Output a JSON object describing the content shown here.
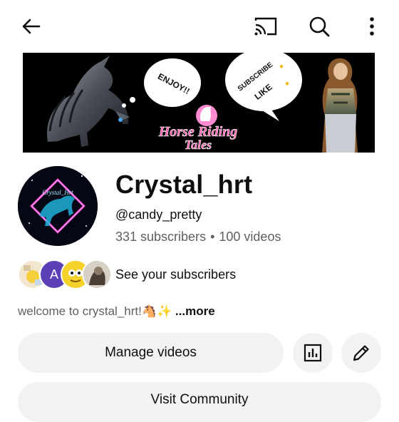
{
  "icons": {
    "back": "arrow-back-icon",
    "cast": "cast-icon",
    "search": "search-icon",
    "more": "more-vertical-icon",
    "analytics": "analytics-chart-icon",
    "edit": "pencil-edit-icon"
  },
  "banner": {
    "bubble_left": "ENJOY!!",
    "bubble_right_line1": "SUBSCRIBE",
    "bubble_right_line2": "LIKE",
    "logo_line1": "Horse Riding",
    "logo_line2": "Tales"
  },
  "channel": {
    "avatar_text": "Crystal_Hrt",
    "name": "Crystal_hrt",
    "handle": "@candy_pretty",
    "subscribers": "331 subscribers",
    "separator": "•",
    "videos": "100 videos"
  },
  "subscribers_preview": {
    "avatar_letter": "A",
    "label": "See your subscribers"
  },
  "description": {
    "text": "welcome to crystal_hrt!🐴✨",
    "more": "...more"
  },
  "buttons": {
    "manage_videos": "Manage videos",
    "visit_community": "Visit Community"
  },
  "colors": {
    "accent_avatar": "#5b3fb6",
    "pink_logo": "#ff5fb0",
    "button_bg": "#f2f2f2",
    "secondary_text": "#606060"
  }
}
